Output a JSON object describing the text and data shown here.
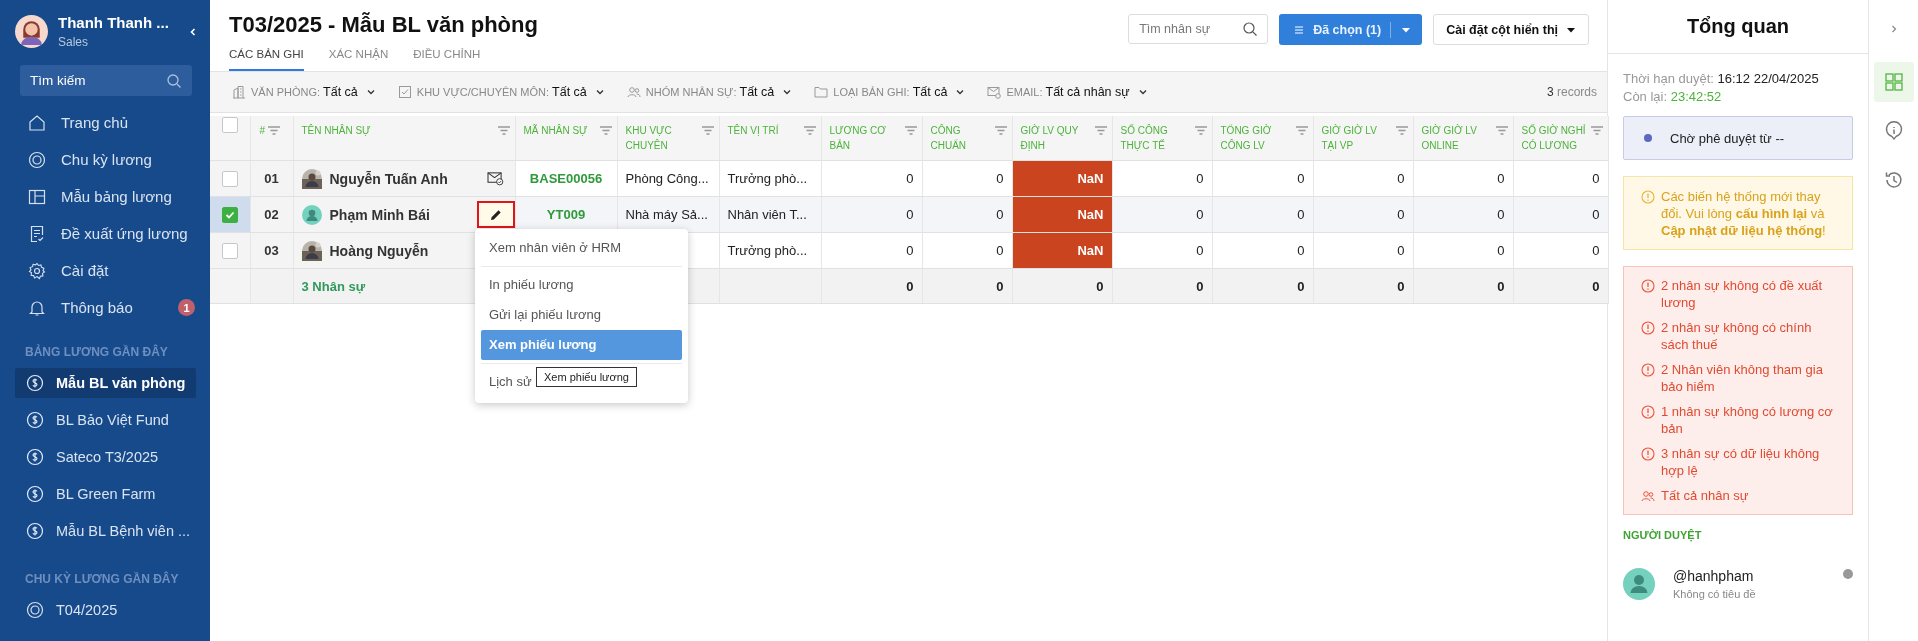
{
  "sidebar": {
    "user": {
      "name": "Thanh Thanh ...",
      "role": "Sales"
    },
    "search": {
      "placeholder": "Tìm kiếm"
    },
    "nav": [
      {
        "label": "Trang chủ",
        "kind": "home"
      },
      {
        "label": "Chu kỳ lương",
        "kind": "cycle"
      },
      {
        "label": "Mẫu bảng lương",
        "kind": "template"
      },
      {
        "label": "Đề xuất ứng lương",
        "kind": "proposal"
      },
      {
        "label": "Cài đặt",
        "kind": "settings"
      },
      {
        "label": "Thông báo",
        "kind": "bell",
        "badge": "1"
      }
    ],
    "sections": [
      {
        "title": "BẢNG LƯƠNG GẦN ĐÂY",
        "kind": "payroll",
        "items": [
          {
            "label": "Mẫu BL văn phòng",
            "selected": true
          },
          {
            "label": "BL Bảo Việt Fund",
            "selected": false
          },
          {
            "label": "Sateco T3/2025",
            "selected": false
          },
          {
            "label": "BL Green Farm",
            "selected": false
          },
          {
            "label": "Mẫu BL Bệnh viên ...",
            "selected": false
          }
        ]
      },
      {
        "title": "CHU KỲ LƯƠNG GẦN ĐÂY",
        "kind": "cycle",
        "items": [
          {
            "label": "T04/2025",
            "selected": false
          }
        ]
      }
    ]
  },
  "header": {
    "title": "T03/2025 - Mẫu BL văn phòng",
    "tabs": [
      {
        "label": "CÁC BẢN GHI",
        "selected": true
      },
      {
        "label": "XÁC NHẬN",
        "selected": false
      },
      {
        "label": "ĐIỀU CHỈNH",
        "selected": false
      }
    ],
    "search": {
      "placeholder": "Tìm nhân sự"
    },
    "selected_button": "Đã chọn (1)",
    "columns_button": "Cài đặt cột hiển thị"
  },
  "filters": {
    "items": [
      {
        "kind": "office",
        "label": "VĂN PHÒNG:",
        "value": "Tất cả"
      },
      {
        "kind": "area",
        "label": "KHU VỰC/CHUYÊN MÔN:",
        "value": "Tất cả"
      },
      {
        "kind": "group",
        "label": "NHÓM NHÂN SỰ:",
        "value": "Tất cả"
      },
      {
        "kind": "folder",
        "label": "LOẠI BẢN GHI:",
        "value": "Tất cả"
      },
      {
        "kind": "email",
        "label": "EMAIL:",
        "value": "Tất cả nhân sự"
      }
    ],
    "count": "3",
    "count_unit": "records"
  },
  "table": {
    "header_checked": false,
    "columns": [
      {
        "label": "#"
      },
      {
        "label": "TÊN NHÂN SỰ"
      },
      {
        "label": "MÃ NHÂN SỰ"
      },
      {
        "label": "KHU VỰC CHUYÊN"
      },
      {
        "label": "TÊN VỊ TRÍ"
      },
      {
        "label": "LƯƠNG CƠ BẢN"
      },
      {
        "label": "CÔNG CHUẨN"
      },
      {
        "label": "GIỜ LV QUY ĐỊNH"
      },
      {
        "label": "SỐ CÔNG THỰC TẾ"
      },
      {
        "label": "TỔNG GIỜ CÔNG LV"
      },
      {
        "label": "GIỜ GIỜ LV TẠI VP"
      },
      {
        "label": "GIỜ GIỜ LV ONLINE"
      },
      {
        "label": "SỐ GIỜ NGHỈ CÓ LƯƠNG"
      }
    ],
    "rows": [
      {
        "checked": false,
        "has_photo": true,
        "mail_sent": true,
        "menu_open": false,
        "cells": [
          {
            "text": "01",
            "error": false
          },
          {
            "text": "Nguyễn Tuấn Anh",
            "error": false
          },
          {
            "text": "BASE00056",
            "error": false
          },
          {
            "text": "Phòng Công...",
            "error": false
          },
          {
            "text": "Trưởng phò...",
            "error": false
          },
          {
            "text": "0",
            "error": false
          },
          {
            "text": "0",
            "error": false
          },
          {
            "text": "NaN",
            "error": true
          },
          {
            "text": "0",
            "error": false
          },
          {
            "text": "0",
            "error": false
          },
          {
            "text": "0",
            "error": false
          },
          {
            "text": "0",
            "error": false
          },
          {
            "text": "0",
            "error": false
          }
        ]
      },
      {
        "checked": true,
        "has_photo": false,
        "mail_sent": false,
        "menu_open": true,
        "cells": [
          {
            "text": "02",
            "error": false
          },
          {
            "text": "Phạm Minh Bái",
            "error": false
          },
          {
            "text": "YT009",
            "error": false
          },
          {
            "text": "Nhà máy Sả...",
            "error": false
          },
          {
            "text": "Nhân viên T...",
            "error": false
          },
          {
            "text": "0",
            "error": false
          },
          {
            "text": "0",
            "error": false
          },
          {
            "text": "NaN",
            "error": true
          },
          {
            "text": "0",
            "error": false
          },
          {
            "text": "0",
            "error": false
          },
          {
            "text": "0",
            "error": false
          },
          {
            "text": "0",
            "error": false
          },
          {
            "text": "0",
            "error": false
          }
        ]
      },
      {
        "checked": false,
        "has_photo": true,
        "mail_sent": false,
        "menu_open": false,
        "cells": [
          {
            "text": "03",
            "error": false
          },
          {
            "text": "Hoàng Nguyễn",
            "error": false
          },
          {
            "text": ""
          },
          {
            "text": ""
          },
          {
            "text": "Trưởng phò...",
            "error": false
          },
          {
            "text": "0",
            "error": false
          },
          {
            "text": "0",
            "error": false
          },
          {
            "text": "NaN",
            "error": true
          },
          {
            "text": "0",
            "error": false
          },
          {
            "text": "0",
            "error": false
          },
          {
            "text": "0",
            "error": false
          },
          {
            "text": "0",
            "error": false
          },
          {
            "text": "0",
            "error": false
          }
        ]
      }
    ],
    "total": {
      "cells": [
        "",
        "3 Nhân sự",
        "",
        "",
        "",
        "0",
        "0",
        "0",
        "0",
        "0",
        "0",
        "0",
        "0"
      ]
    }
  },
  "context_menu": {
    "groups": [
      [
        {
          "label": "Xem nhân viên ở HRM",
          "selected": false
        }
      ],
      [
        {
          "label": "In phiếu lương",
          "selected": false
        },
        {
          "label": "Gửi lại phiếu lương",
          "selected": false
        },
        {
          "label": "Xem phiếu lương",
          "selected": true
        }
      ],
      [
        {
          "label": "Lịch sử",
          "selected": false
        }
      ]
    ],
    "tooltip": "Xem phiếu lương"
  },
  "overview": {
    "title": "Tổng quan",
    "deadline": {
      "label": "Thời hạn duyệt:",
      "value": "16:12 22/04/2025"
    },
    "remaining": {
      "label": "Còn lại:",
      "value": "23:42:52"
    },
    "status": "Chờ phê duyệt từ --",
    "warning": "Các biến hệ thống mới thay đổi. Vui lòng **cấu hình lại** và **Cập nhật dữ liệu hệ thống**!",
    "issues": [
      {
        "kind": "issue",
        "text": "2 nhân sự không có đề xuất lương"
      },
      {
        "kind": "issue",
        "text": "2 nhân sự không có chính sách thuế"
      },
      {
        "kind": "issue",
        "text": "2 Nhân viên không tham gia bảo hiểm"
      },
      {
        "kind": "issue",
        "text": "1 nhân sự không có lương cơ bản"
      },
      {
        "kind": "issue",
        "text": "3 nhân sự có dữ liệu không hợp lệ"
      },
      {
        "kind": "link",
        "text": "Tất cả nhân sự"
      }
    ],
    "reviewers_title": "NGƯỜI DUYỆT",
    "reviewers": [
      {
        "handle": "@hanhpham",
        "subtitle": "Không có tiêu đề",
        "online": false
      }
    ]
  },
  "rail": [
    {
      "kind": "dashboard",
      "selected": true
    },
    {
      "kind": "info",
      "selected": false
    },
    {
      "kind": "history",
      "selected": false
    }
  ]
}
